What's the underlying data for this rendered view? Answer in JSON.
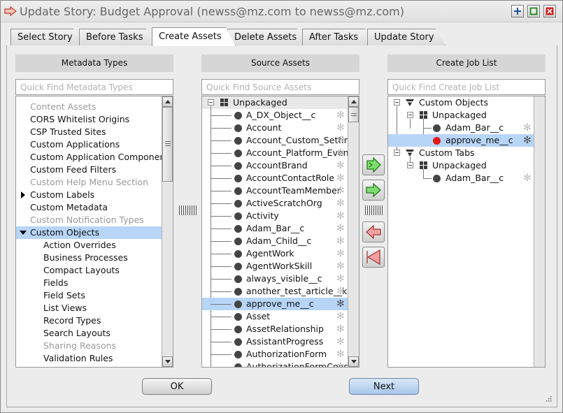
{
  "window": {
    "title": "Update Story: Budget Approval (newss@mz.com to newss@mz.com)",
    "controls": [
      "add-icon",
      "maximize-icon",
      "close-icon"
    ]
  },
  "tabs": [
    {
      "label": "Select Story"
    },
    {
      "label": "Before Tasks"
    },
    {
      "label": "Create Assets",
      "active": true
    },
    {
      "label": "Delete Assets"
    },
    {
      "label": "After Tasks"
    },
    {
      "label": "Update Story"
    }
  ],
  "metadata_panel": {
    "header": "Metadata Types",
    "placeholder": "Quick Find Metadata Types",
    "items": [
      {
        "label": "Content Assets",
        "dim": true
      },
      {
        "label": "CORS Whitelist Origins"
      },
      {
        "label": "CSP Trusted Sites"
      },
      {
        "label": "Custom Applications"
      },
      {
        "label": "Custom Application Components"
      },
      {
        "label": "Custom Feed Filters"
      },
      {
        "label": "Custom Help Menu Section",
        "dim": true
      },
      {
        "label": "Custom Labels"
      },
      {
        "label": "Custom Metadata"
      },
      {
        "label": "Custom Notification Types",
        "dim": true
      },
      {
        "label": "Custom Objects",
        "selected": true
      },
      {
        "label": "Action Overrides"
      },
      {
        "label": "Business Processes"
      },
      {
        "label": "Compact Layouts"
      },
      {
        "label": "Fields"
      },
      {
        "label": "Field Sets"
      },
      {
        "label": "List Views"
      },
      {
        "label": "Record Types"
      },
      {
        "label": "Search Layouts"
      },
      {
        "label": "Sharing Reasons",
        "dim": true
      },
      {
        "label": "Validation Rules"
      }
    ]
  },
  "source_panel": {
    "header": "Source Assets",
    "placeholder": "Quick Find Source Assets",
    "root": "Unpackaged",
    "items": [
      {
        "label": "A_DX_Object__c"
      },
      {
        "label": "Account"
      },
      {
        "label": "Account_Custom_Settings"
      },
      {
        "label": "Account_Platform_Event_"
      },
      {
        "label": "AccountBrand"
      },
      {
        "label": "AccountContactRole"
      },
      {
        "label": "AccountTeamMember"
      },
      {
        "label": "ActiveScratchOrg"
      },
      {
        "label": "Activity"
      },
      {
        "label": "Adam_Bar__c"
      },
      {
        "label": "Adam_Child__c"
      },
      {
        "label": "AgentWork"
      },
      {
        "label": "AgentWorkSkill"
      },
      {
        "label": "always_visible__c"
      },
      {
        "label": "another_test_article__kav"
      },
      {
        "label": "approve_me__c",
        "selected": true
      },
      {
        "label": "Asset"
      },
      {
        "label": "AssetRelationship"
      },
      {
        "label": "AssistantProgress"
      },
      {
        "label": "AuthorizationForm"
      },
      {
        "label": "AuthorizationFormConsent"
      }
    ]
  },
  "job_panel": {
    "header": "Create Job List",
    "placeholder": "Quick Find Create Job List",
    "tree": {
      "custom_objects": "Custom Objects",
      "unpackaged_1": "Unpackaged",
      "adam_bar_1": "Adam_Bar__c",
      "approve_me": "approve_me__c",
      "custom_tabs": "Custom Tabs",
      "unpackaged_2": "Unpackaged",
      "adam_bar_2": "Adam_Bar__c"
    }
  },
  "buttons": {
    "ok": "OK",
    "next": "Next"
  },
  "colors": {
    "selection": "#b7d5f7",
    "add_arrow": "#7ddc6e",
    "remove_arrow": "#f0a0a0",
    "status_red": "#e01818"
  }
}
